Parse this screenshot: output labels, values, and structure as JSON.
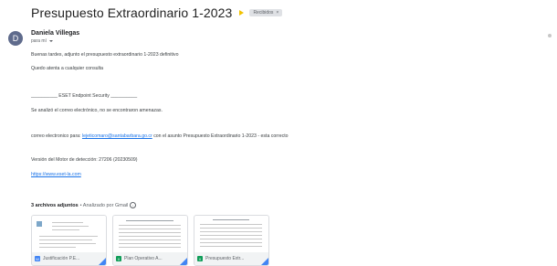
{
  "subject": "Presupuesto Extraordinario 1-2023",
  "label": "Recibidos",
  "label_close": "×",
  "sender": {
    "initial": "D",
    "name": "Daniela Villegas",
    "recipient": "para mí"
  },
  "body": {
    "greeting": "Buenas tardes, adjunto el presupuesto extraordinario 1-2023 definitivo",
    "closing": "Quedo atenta a cualquier consulta",
    "eset_banner": "__________ ESET Endpoint Security __________",
    "scan_result": "Se analizó el correo electrónico, no se encontraron amenazas.",
    "email_prefix": "correo electronico para:",
    "email_link": "lejeticomaro@santabarbara.go.cr",
    "email_suffix": "con el asunto Presupuesto Extraordinario 1-2023 - esta correcto",
    "engine_version": "Versión del Motor de detección: 27206 (20230509)",
    "eset_link": "https://www.eset-la.com"
  },
  "attachments": {
    "count_label": "3 archivos adjuntos",
    "scan_label": "• Analizado por Gmail",
    "info_icon": "i",
    "files": [
      {
        "name": "Justificación P.E...",
        "badge": "W",
        "color": "#4285f4"
      },
      {
        "name": "Plan Operativo A...",
        "badge": "X",
        "color": "#0f9d58"
      },
      {
        "name": "Presupuesto Extr...",
        "badge": "X",
        "color": "#0f9d58"
      }
    ]
  }
}
